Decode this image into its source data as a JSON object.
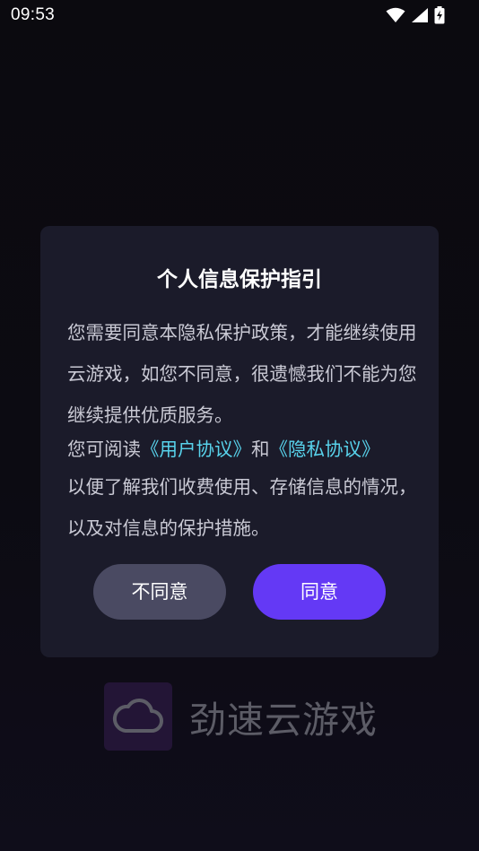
{
  "status_bar": {
    "time": "09:53",
    "icons": [
      "wifi-icon",
      "cell-signal-icon",
      "battery-charging-icon"
    ]
  },
  "dialog": {
    "title": "个人信息保护指引",
    "paragraph1": "您需要同意本隐私保护政策，才能继续使用云游戏，如您不同意，很遗憾我们不能为您继续提供优质服务。",
    "paragraph2_prefix": "您可阅读",
    "user_agreement_link": "《用户协议》",
    "conjunction": "和",
    "privacy_agreement_link": "《隐私协议》",
    "paragraph3": "以便了解我们收费使用、存储信息的情况，以及对信息的保护措施。",
    "decline_label": "不同意",
    "agree_label": "同意"
  },
  "brand": {
    "logo_icon": "cloud-icon",
    "name": "劲速云游戏"
  },
  "colors": {
    "background": "#0c0b12",
    "dialog_bg": "#1b1b2a",
    "link": "#58d3ec",
    "agree_button": "#6439f5",
    "decline_button": "#4a4a62",
    "brand_text": "#5c5c66",
    "logo_bg": "#231536"
  }
}
